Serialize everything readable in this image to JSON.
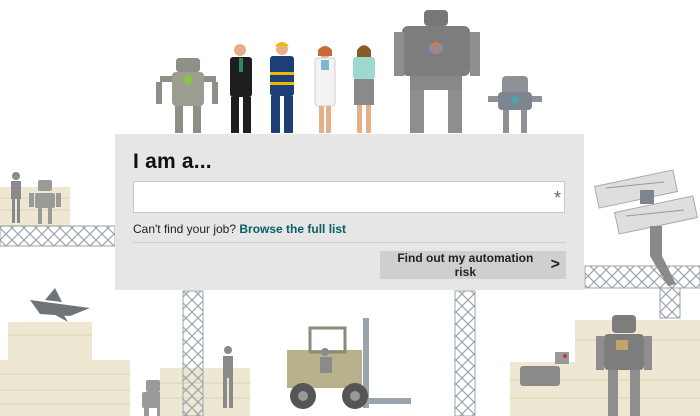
{
  "form": {
    "heading": "I am a...",
    "job_input_value": "",
    "job_input_placeholder": "",
    "required_marker": "*",
    "help_text": "Can't find your job?",
    "browse_link": "Browse the full list",
    "submit_label": "Find out my automation risk",
    "submit_icon": "chevron-right-icon",
    "submit_glyph": ">"
  },
  "colors": {
    "panel_bg": "#e6e6e6",
    "link": "#0b5f66",
    "button_bg": "#cfcfcf",
    "robot_grey": "#7d7d7d",
    "crate_beige": "#eee7d2",
    "scaffold": "#9aa4ad"
  },
  "illustration": {
    "figures": [
      "robot-icon",
      "businessman-icon",
      "worker-icon",
      "doctor-icon",
      "teacher-icon",
      "large-robot-icon",
      "small-robot-icon"
    ],
    "background_items": [
      "scaffold-icon",
      "forklift-icon",
      "robot-dog-icon",
      "fighter-jet-icon",
      "flying-robot-icon",
      "crate-icon"
    ]
  }
}
